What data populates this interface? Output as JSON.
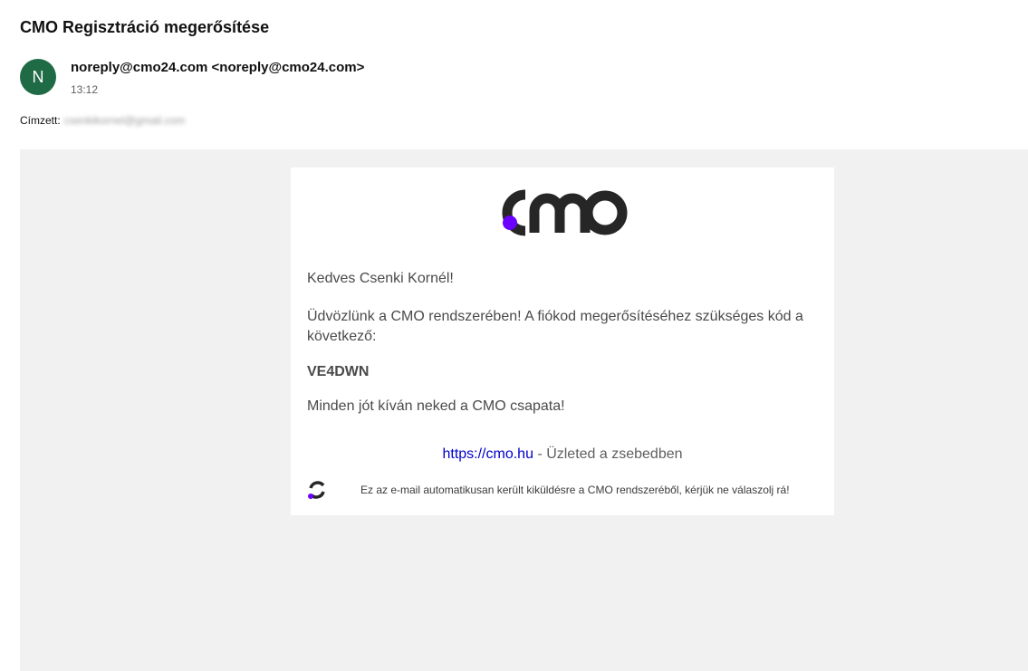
{
  "email": {
    "subject": "CMO Regisztráció megerősítése",
    "avatar_letter": "N",
    "sender_name": "noreply@cmo24.com",
    "sender_email": "<noreply@cmo24.com>",
    "time": "13:12",
    "recipient_label": "Címzett:",
    "recipient_value": "csenkikornel@gmail.com"
  },
  "message": {
    "greeting": "Kedves Csenki Kornél!",
    "intro": "Üdvözlünk a CMO rendszerében! A fiókod megerősítéséhez szükséges kód a következő:",
    "code": "VE4DWN",
    "signoff": "Minden jót kíván neked a CMO csapata!",
    "footer_link": "https://cmo.hu",
    "footer_tagline": " - Üzleted a zsebedben",
    "footer_note": "Ez az e-mail automatikusan került kiküldésre a CMO rendszeréből, kérjük ne válaszolj rá!"
  },
  "colors": {
    "avatar_bg": "#1e6b45",
    "logo_dark": "#262626",
    "logo_accent": "#6a00ff",
    "canvas_bg": "#f1f1f1",
    "link": "#0000cc"
  },
  "icons": {
    "brand_logo": "cmo-logo",
    "footer_logo": "cmo-mark-icon"
  }
}
